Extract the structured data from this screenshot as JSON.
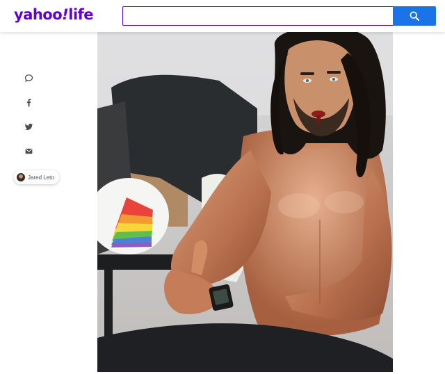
{
  "header": {
    "logo_primary": "yahoo",
    "logo_slash": "!",
    "logo_secondary": "life",
    "search_placeholder": "",
    "search_icon": "search-icon"
  },
  "share_rail": {
    "items": [
      {
        "icon": "comment-icon"
      },
      {
        "icon": "facebook-icon"
      },
      {
        "icon": "twitter-icon"
      },
      {
        "icon": "mail-icon"
      }
    ],
    "tag_label": "Jared Leto"
  },
  "photo": {
    "subject": "photo"
  },
  "colors": {
    "brand": "#6001d2",
    "search_button": "#1a73e8",
    "icon": "#464e56"
  }
}
